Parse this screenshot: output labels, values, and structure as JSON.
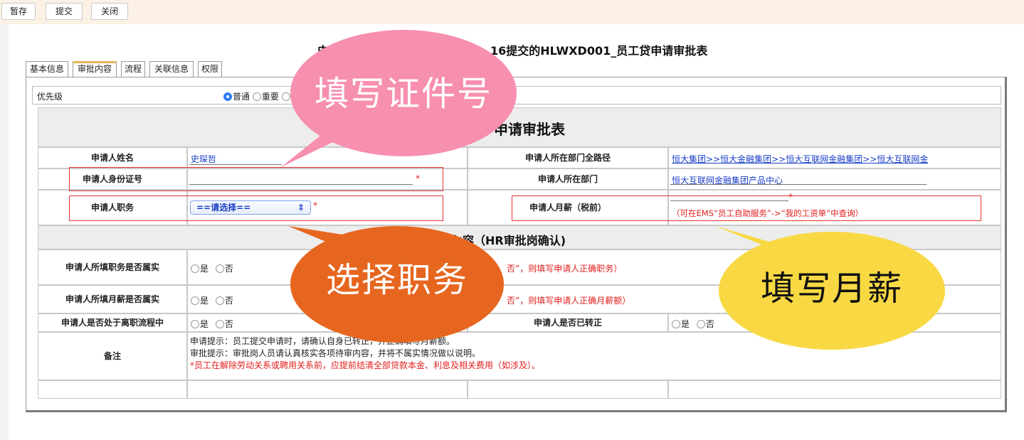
{
  "toolbar": {
    "save": "暂存",
    "submit": "提交",
    "close": "关闭"
  },
  "title": {
    "left": "史環",
    "right": "16提交的HLWXD001_员工贷申请审批表"
  },
  "tabs": [
    "基本信息",
    "审批内容",
    "流程",
    "关联信息",
    "权限"
  ],
  "priority": {
    "label": "优先级",
    "opt1": "普通",
    "opt2": "重要"
  },
  "form": {
    "section1_title": "申请审批表",
    "name_label": "申请人姓名",
    "name_value": "史琛哲",
    "dept_path_label": "申请人所在部门全路径",
    "dept_path_value": "恒大集团>>恒大金融集团>>恒大互联网金融集团>>恒大互联网金",
    "id_label": "申请人身份证号",
    "dept_label": "申请人所在部门",
    "dept_value": "恒大互联网金融集团产品中心",
    "job_label": "申请人职务",
    "job_select": "==请选择==",
    "salary_label": "申请人月薪（税前）",
    "salary_hint": "（可在EMS“员工自助服务”->“我的工资单”中查询）",
    "required_mark": "*",
    "section2_title": "內容（HR审批岗确认)",
    "job_true_label": "申请人所填职务是否属实",
    "job_true_hint": "否”，则填写申请人正确职务）",
    "salary_true_label": "申请人所填月薪是否属实",
    "salary_true_hint": "否”，则填写申请人正确月薪额）",
    "resign_label": "申请人是否处于离职流程中",
    "regular_label": "申请人是否已转正",
    "yes": "是",
    "no": "否",
    "remark_label": "备注",
    "remark_line1": "申请提示：员工提交申请时，请确认自身已转正，并正确填写月薪额。",
    "remark_line2": "审批提示：审批岗人员请认真核实各项待审内容，并将不属实情况做以说明。",
    "remark_line3": "*员工在解除劳动关系或聘用关系前，应提前结清全部贷款本金、利息及相关费用（如涉及）。"
  },
  "callouts": {
    "id": "填写证件号",
    "job": "选择职务",
    "salary": "填写月薪"
  },
  "colors": {
    "pink": "#f78fae",
    "orange": "#e7661f",
    "yellow": "#f8d944",
    "red": "#e21c1c",
    "link": "#1a3fc7"
  }
}
